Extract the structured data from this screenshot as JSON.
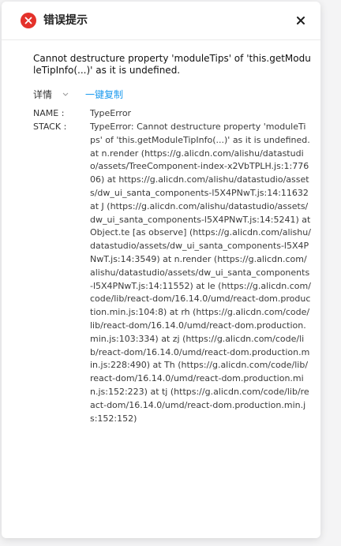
{
  "dialog": {
    "title": "错误提示",
    "icon": "error-icon",
    "close_icon": "close-icon",
    "accent_color": "#e4322b",
    "link_color": "#1b9aee"
  },
  "message": "Cannot destructure property 'moduleTips' of 'this.getModuleTipInfo(...)' as it is undefined.",
  "details": {
    "label": "详情",
    "copy_label": "一键复制"
  },
  "error": {
    "name_key": "NAME :",
    "name_value": "TypeError",
    "stack_key": "STACK :",
    "stack_value": "TypeError: Cannot destructure property 'moduleTips' of 'this.getModuleTipInfo(...)' as it is undefined. at n.render (https://g.alicdn.com/alishu/datastudio/assets/TreeComponent-index-x2VbTPLH.js:1:77606) at https://g.alicdn.com/alishu/datastudio/assets/dw_ui_santa_components-l5X4PNwT.js:14:11632 at J (https://g.alicdn.com/alishu/datastudio/assets/dw_ui_santa_components-l5X4PNwT.js:14:5241) at Object.te [as observe] (https://g.alicdn.com/alishu/datastudio/assets/dw_ui_santa_components-l5X4PNwT.js:14:3549) at n.render (https://g.alicdn.com/alishu/datastudio/assets/dw_ui_santa_components-l5X4PNwT.js:14:11552) at le (https://g.alicdn.com/code/lib/react-dom/16.14.0/umd/react-dom.production.min.js:104:8) at rh (https://g.alicdn.com/code/lib/react-dom/16.14.0/umd/react-dom.production.min.js:103:334) at zj (https://g.alicdn.com/code/lib/react-dom/16.14.0/umd/react-dom.production.min.js:228:490) at Th (https://g.alicdn.com/code/lib/react-dom/16.14.0/umd/react-dom.production.min.js:152:223) at tj (https://g.alicdn.com/code/lib/react-dom/16.14.0/umd/react-dom.production.min.js:152:152)"
  }
}
